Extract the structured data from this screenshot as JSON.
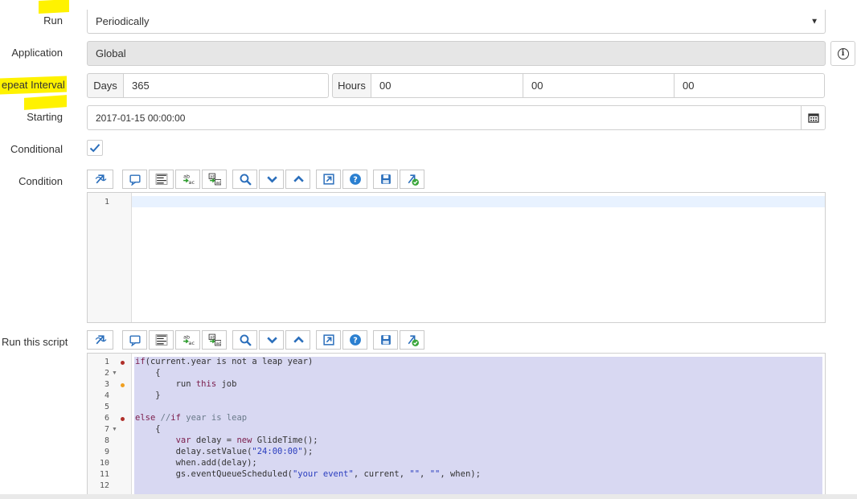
{
  "form": {
    "run": {
      "label": "Run",
      "value": "Periodically"
    },
    "application": {
      "label": "Application",
      "value": "Global"
    },
    "repeat_interval": {
      "label": "epeat Interval",
      "days_label": "Days",
      "days_value": "365",
      "hours_label": "Hours",
      "hours_value": "00",
      "minutes_value": "00",
      "seconds_value": "00"
    },
    "starting": {
      "label": "Starting",
      "value": "2017-01-15 00:00:00"
    },
    "conditional": {
      "label": "Conditional",
      "checked": true
    },
    "condition": {
      "label": "Condition",
      "lines": [
        "1"
      ]
    },
    "script": {
      "label": "Run this script",
      "line_numbers": [
        "1",
        "2",
        "3",
        "4",
        "5",
        "6",
        "7",
        "8",
        "9",
        "10",
        "11",
        "12"
      ],
      "lines": [
        "if(current.year is not a leap year)",
        "    {",
        "        run this job",
        "    }",
        "",
        "else //if year is leap",
        "    {",
        "        var delay = new GlideTime();",
        "        delay.setValue(\"24:00:00\");",
        "        when.add(delay);",
        "        gs.eventQueueScheduled(\"your event\", current, \"\", \"\", when);",
        ""
      ]
    }
  },
  "toolbar_icons": [
    "script-include-icon",
    "comment-icon",
    "format-icon",
    "replace-icon",
    "replace-all-icon",
    "search-icon",
    "find-next-icon",
    "find-previous-icon",
    "fullscreen-icon",
    "help-icon",
    "save-icon",
    "syntax-check-icon"
  ],
  "colors": {
    "highlight": "#fff200",
    "script_bg": "#d8d8f2",
    "checkbox": "#2a6ebb",
    "icon_blue": "#2a6ebb"
  }
}
